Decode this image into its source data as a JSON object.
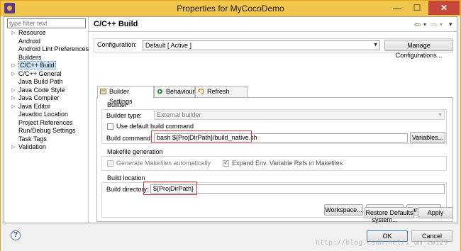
{
  "window": {
    "title": "Properties for MyCocoDemo",
    "buttons": {
      "minimize": "—",
      "maximize": "☐",
      "close": "✕"
    }
  },
  "sidebar": {
    "filter_placeholder": "type filter text",
    "items": [
      {
        "label": "Resource",
        "arrow": "▷"
      },
      {
        "label": "Android",
        "arrow": ""
      },
      {
        "label": "Android Lint Preferences",
        "arrow": ""
      },
      {
        "label": "Builders",
        "arrow": ""
      },
      {
        "label": "C/C++ Build",
        "arrow": "▷",
        "selected": true
      },
      {
        "label": "C/C++ General",
        "arrow": "▷"
      },
      {
        "label": "Java Build Path",
        "arrow": ""
      },
      {
        "label": "Java Code Style",
        "arrow": "▷"
      },
      {
        "label": "Java Compiler",
        "arrow": "▷"
      },
      {
        "label": "Java Editor",
        "arrow": "▷"
      },
      {
        "label": "Javadoc Location",
        "arrow": ""
      },
      {
        "label": "Project References",
        "arrow": ""
      },
      {
        "label": "Run/Debug Settings",
        "arrow": ""
      },
      {
        "label": "Task Tags",
        "arrow": ""
      },
      {
        "label": "Validation",
        "arrow": "▷"
      }
    ]
  },
  "header": {
    "title": "C/C++ Build",
    "nav": {
      "back": "⇦",
      "back_dd": "▾",
      "forward": "⇨",
      "forward_dd": "▾",
      "menu": "▾"
    }
  },
  "configuration": {
    "label": "Configuration:",
    "value": "Default  [ Active ]",
    "manage_button": "Manage Configurations..."
  },
  "tabs": [
    {
      "label": "Builder Settings",
      "active": true
    },
    {
      "label": "Behaviour",
      "active": false
    },
    {
      "label": "Refresh Policy",
      "active": false
    }
  ],
  "builder": {
    "group_title": "Builder",
    "type_label": "Builder type:",
    "type_value": "External builder",
    "use_default_label": "Use default build command",
    "use_default_checked": false,
    "command_label": "Build command:",
    "command_value": "bash ${ProjDirPath}/build_native.sh",
    "variables_button": "Variables..."
  },
  "makefile": {
    "group_title": "Makefile generation",
    "generate_label": "Generate Makefiles automatically",
    "generate_checked": false,
    "expand_label": "Expand Env. Variable Refs in Makefiles",
    "expand_checked": true
  },
  "location": {
    "group_title": "Build location",
    "directory_label": "Build directory:",
    "directory_value": "${ProjDirPath}",
    "workspace_button": "Workspace...",
    "filesystem_button": "File system...",
    "variables_button": "Variables..."
  },
  "actions": {
    "restore_defaults": "Restore Defaults",
    "apply": "Apply",
    "ok": "OK",
    "cancel": "Cancel"
  },
  "help_icon": "?",
  "watermark": "http://blog.csdn.net/i_am_zw129",
  "colors": {
    "titlebar": "#f0c54c",
    "highlight": "#d23a3a",
    "selection": "#cde5f7"
  }
}
